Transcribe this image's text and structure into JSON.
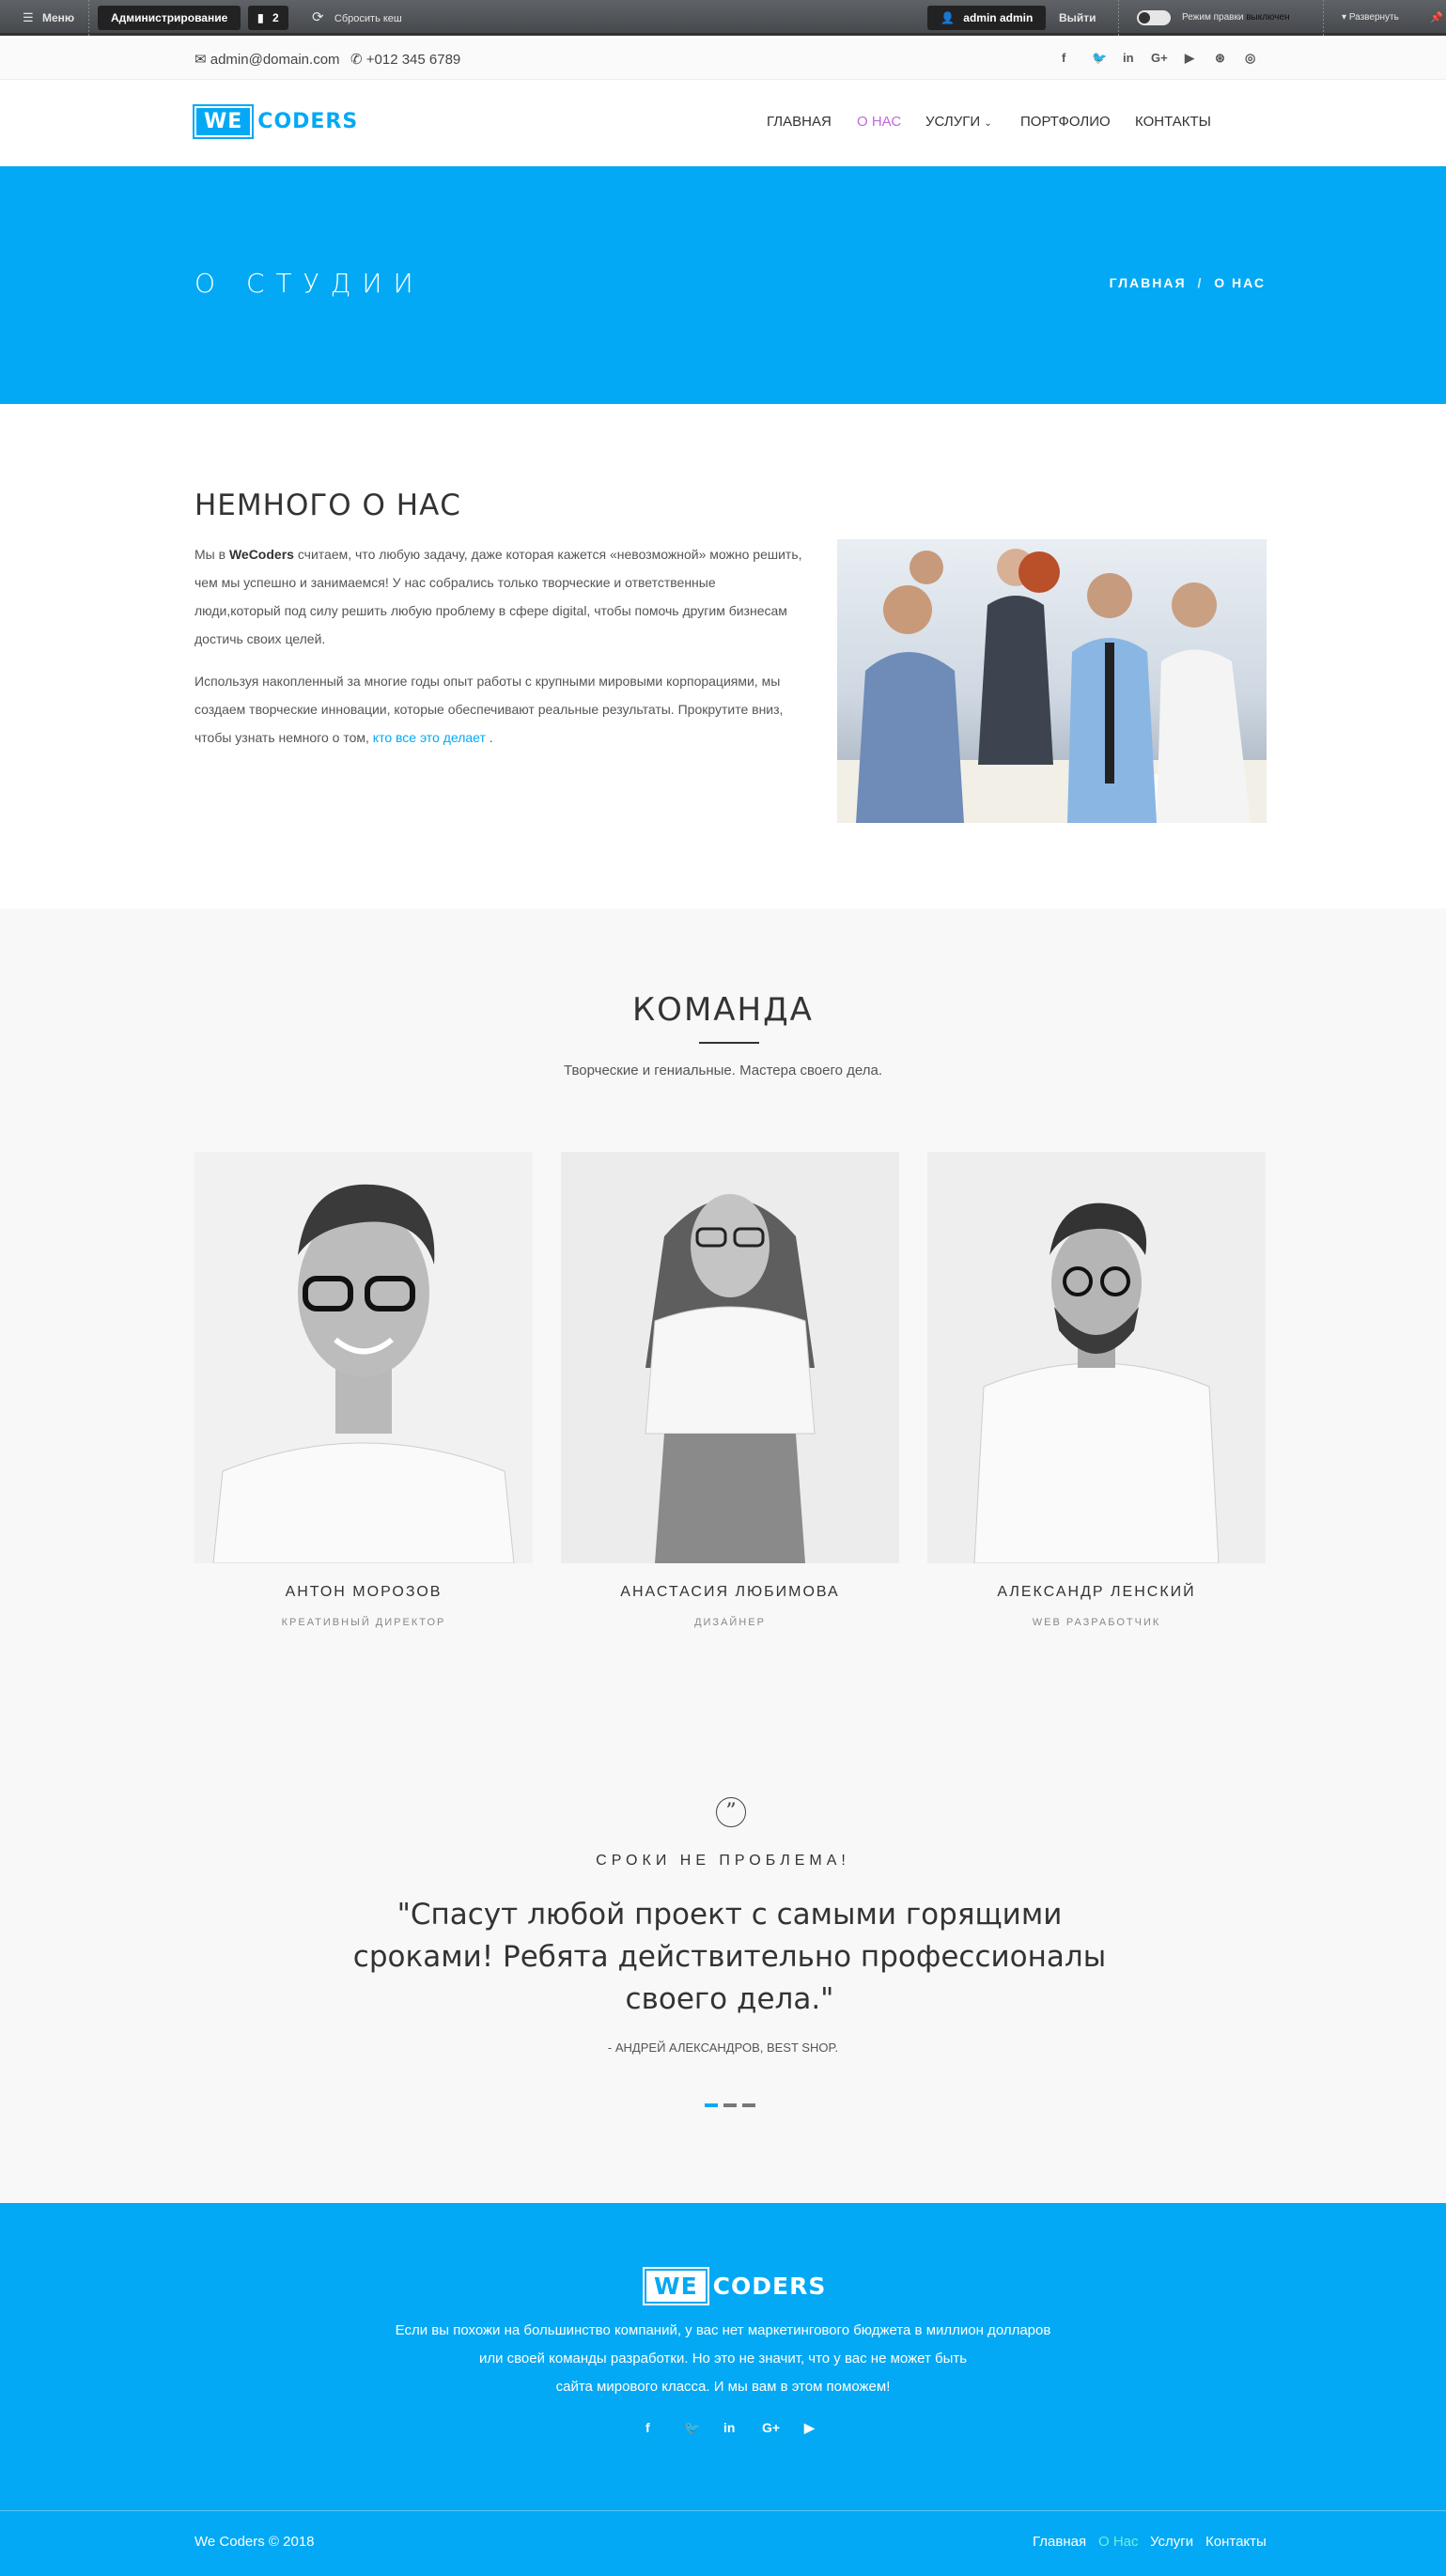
{
  "adminbar": {
    "menu": "Меню",
    "admin": "Администрирование",
    "badge_count": "2",
    "clear_cache": "Сбросить кеш",
    "user": "admin admin",
    "logout": "Выйти",
    "edit_mode": "Режим правки",
    "edit_mode_state": "выключен",
    "expand": "Развернуть"
  },
  "topbar": {
    "email": "admin@domain.com",
    "phone": "+012 345 6789"
  },
  "logo": {
    "box": "WE",
    "text": "CODERS"
  },
  "nav": [
    "ГЛАВНАЯ",
    "О НАС",
    "УСЛУГИ",
    "ПОРТФОЛИО",
    "КОНТАКТЫ"
  ],
  "hero": {
    "title": "О СТУДИИ",
    "crumb_home": "ГЛАВНАЯ",
    "crumb_sep": "/",
    "crumb_current": "О НАС"
  },
  "about": {
    "title": "НЕМНОГО О НАС",
    "p1_pre": "Мы в ",
    "p1_brand": "WeCoders",
    "p1_post": " считаем, что любую задачу, даже которая кажется «невозможной» можно решить, чем мы успешно и занимаемся! У нас собрались только творческие и ответственные люди,который под силу решить любую проблему в сфере digital, чтобы помочь другим бизнесам достичь своих целей.",
    "p2_pre": "Используя накопленный за многие годы опыт работы с крупными мировыми корпорациями, мы создаем творческие инновации, которые обеспечивают реальные результаты. Прокрутите вниз, чтобы узнать немного о том, ",
    "p2_link": "кто все это делает",
    "p2_post": " ."
  },
  "team": {
    "title": "КОМАНДА",
    "subtitle": "Творческие и гениальные. Мастера своего дела.",
    "members": [
      {
        "name": "АНТОН МОРОЗОВ",
        "role": "КРЕАТИВНЫЙ ДИРЕКТОР"
      },
      {
        "name": "АНАСТАСИЯ ЛЮБИМОВА",
        "role": "ДИЗАЙНЕР"
      },
      {
        "name": "АЛЕКСАНДР ЛЕНСКИЙ",
        "role": "WEB РАЗРАБОТЧИК"
      }
    ]
  },
  "testimonial": {
    "heading": "СРОКИ НЕ ПРОБЛЕМА!",
    "quote": "\"Спасут любой проект с самыми горящими сроками! Ребята действительно профессионалы своего дела.\"",
    "author": "- АНДРЕЙ АЛЕКСАНДРОВ, BEST SHOP."
  },
  "footer": {
    "text_line1": "Если вы похожи на большинство компаний, у вас нет маркетингового бюджета в миллион долларов",
    "text_line2": "или своей команды разработки. Но это не значит, что у вас не может быть",
    "text_line3": "сайта мирового класса. И мы вам в этом поможем!",
    "copyright": "We Coders © 2018",
    "links": [
      "Главная",
      "О Нас",
      "Услуги",
      "Контакты"
    ]
  },
  "colors": {
    "accent": "#03a9f4",
    "nav_active": "#c06ad8",
    "footer_active_link": "#6ff0d8"
  },
  "icons": {
    "social": [
      "facebook-icon",
      "twitter-icon",
      "linkedin-icon",
      "google-plus-icon",
      "youtube-icon",
      "dribbble-icon",
      "instagram-icon"
    ],
    "footer_social": [
      "facebook-icon",
      "twitter-icon",
      "linkedin-icon",
      "google-plus-icon",
      "youtube-icon"
    ]
  }
}
